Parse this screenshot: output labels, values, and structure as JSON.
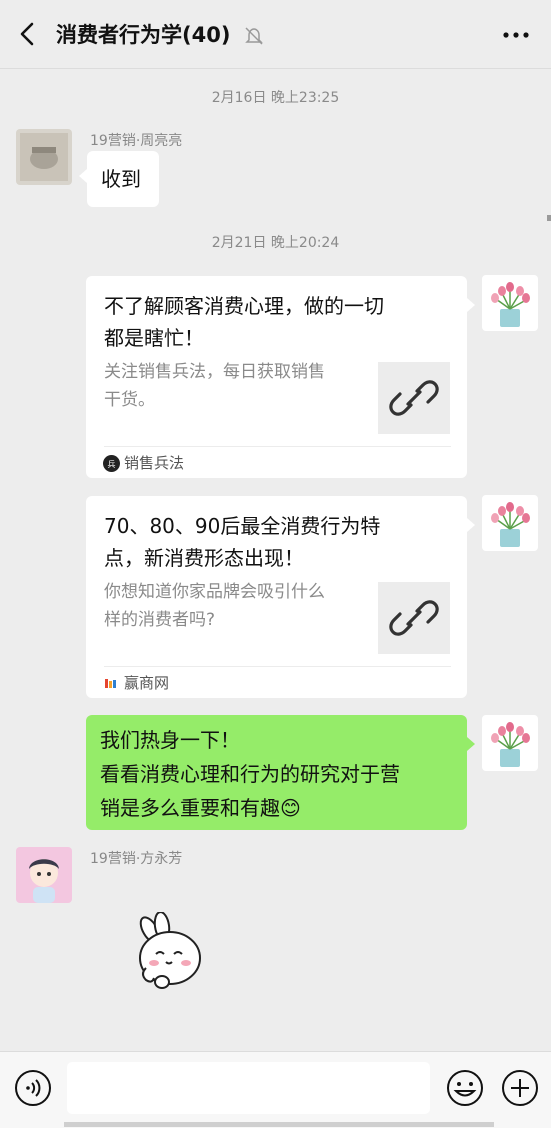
{
  "header": {
    "title": "消费者行为学(40)",
    "back_icon": "chevron-left-icon",
    "mute_icon": "bell-off-icon",
    "more_icon": "more-dots-icon"
  },
  "messages": {
    "ts1": "2月16日 晚上23:25",
    "msg1": {
      "sender": "19营销·周亮亮",
      "text": "收到"
    },
    "ts2": "2月21日 晚上20:24",
    "card1": {
      "title_line1": "不了解顾客消费心理，做的一切",
      "title_line2": "都是瞎忙！",
      "desc_line1": "关注销售兵法，每日获取销售",
      "desc_line2": "干货。",
      "source": "销售兵法"
    },
    "card2": {
      "title_line1": "70、80、90后最全消费行为特",
      "title_line2": "点，新消费形态出现！",
      "desc_line1": "你想知道你家品牌会吸引什么",
      "desc_line2": "样的消费者吗?",
      "source": "赢商网"
    },
    "msg_green": {
      "line1": "我们热身一下！",
      "line2": "看看消费心理和行为的研究对于营",
      "line3": "销是多么重要和有趣😊"
    },
    "msg2": {
      "sender": "19营销·方永芳"
    }
  },
  "input": {
    "value": ""
  },
  "colors": {
    "bg": "#ededed",
    "green_bubble": "#95ec69",
    "bubble": "#ffffff"
  }
}
